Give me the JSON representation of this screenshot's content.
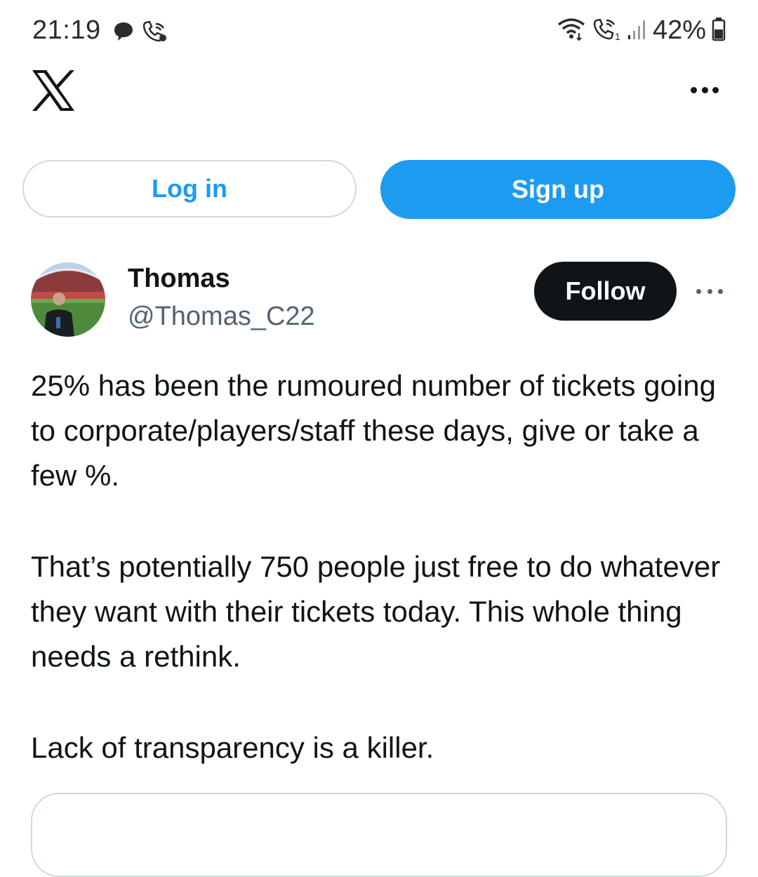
{
  "status_bar": {
    "time": "21:19",
    "battery_percent": "42%",
    "icons_left": [
      "chat-bubble-icon",
      "wifi-call-icon"
    ],
    "icons_right": [
      "wifi-icon",
      "volte-call-icon",
      "signal-icon",
      "battery-icon"
    ]
  },
  "header": {
    "logo": "x-logo-icon",
    "more_icon": "more-horizontal-icon"
  },
  "auth": {
    "login_label": "Log in",
    "signup_label": "Sign up"
  },
  "tweet": {
    "author_name": "Thomas",
    "author_handle": "@Thomas_C22",
    "follow_label": "Follow",
    "paragraphs": [
      "25% has been the rumoured number of tickets going to corporate/players/staff these days, give or take a few %.",
      "That’s potentially 750 people just free to do whatever they want with their tickets today. This whole thing needs a rethink.",
      "Lack of transparency is a killer."
    ]
  },
  "colors": {
    "brand_blue": "#1d9bf0",
    "text_primary": "#0f1419",
    "text_secondary": "#536471",
    "border": "#cfd9de"
  }
}
